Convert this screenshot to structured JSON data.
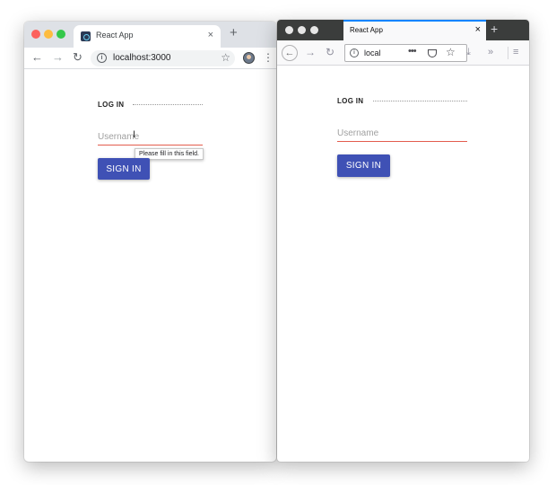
{
  "chrome": {
    "tab_title": "React App",
    "tab_close": "×",
    "new_tab": "+",
    "url": "localhost:3000",
    "info_glyph": "i",
    "back": "←",
    "forward": "→",
    "reload": "↻",
    "star": "☆",
    "menu": "⋮",
    "traffic_lights": [
      "#fc615d",
      "#fdbc40",
      "#34c84a"
    ]
  },
  "firefox": {
    "tab_title": "React App",
    "tab_close": "×",
    "new_tab": "+",
    "url": "local",
    "info_glyph": "i",
    "back": "←",
    "forward": "→",
    "reload": "↻",
    "more": "•••",
    "star": "☆",
    "download": "⤓",
    "overflow": "»",
    "menu": "≡"
  },
  "page": {
    "heading": "LOG IN",
    "username_placeholder": "Username",
    "signin_label": "SIGN IN",
    "tooltip": "Please fill in this field."
  },
  "colors": {
    "button": "#3f51b5",
    "input_underline": "#e35d4e",
    "firefox_tab_accent": "#0a84ff"
  }
}
